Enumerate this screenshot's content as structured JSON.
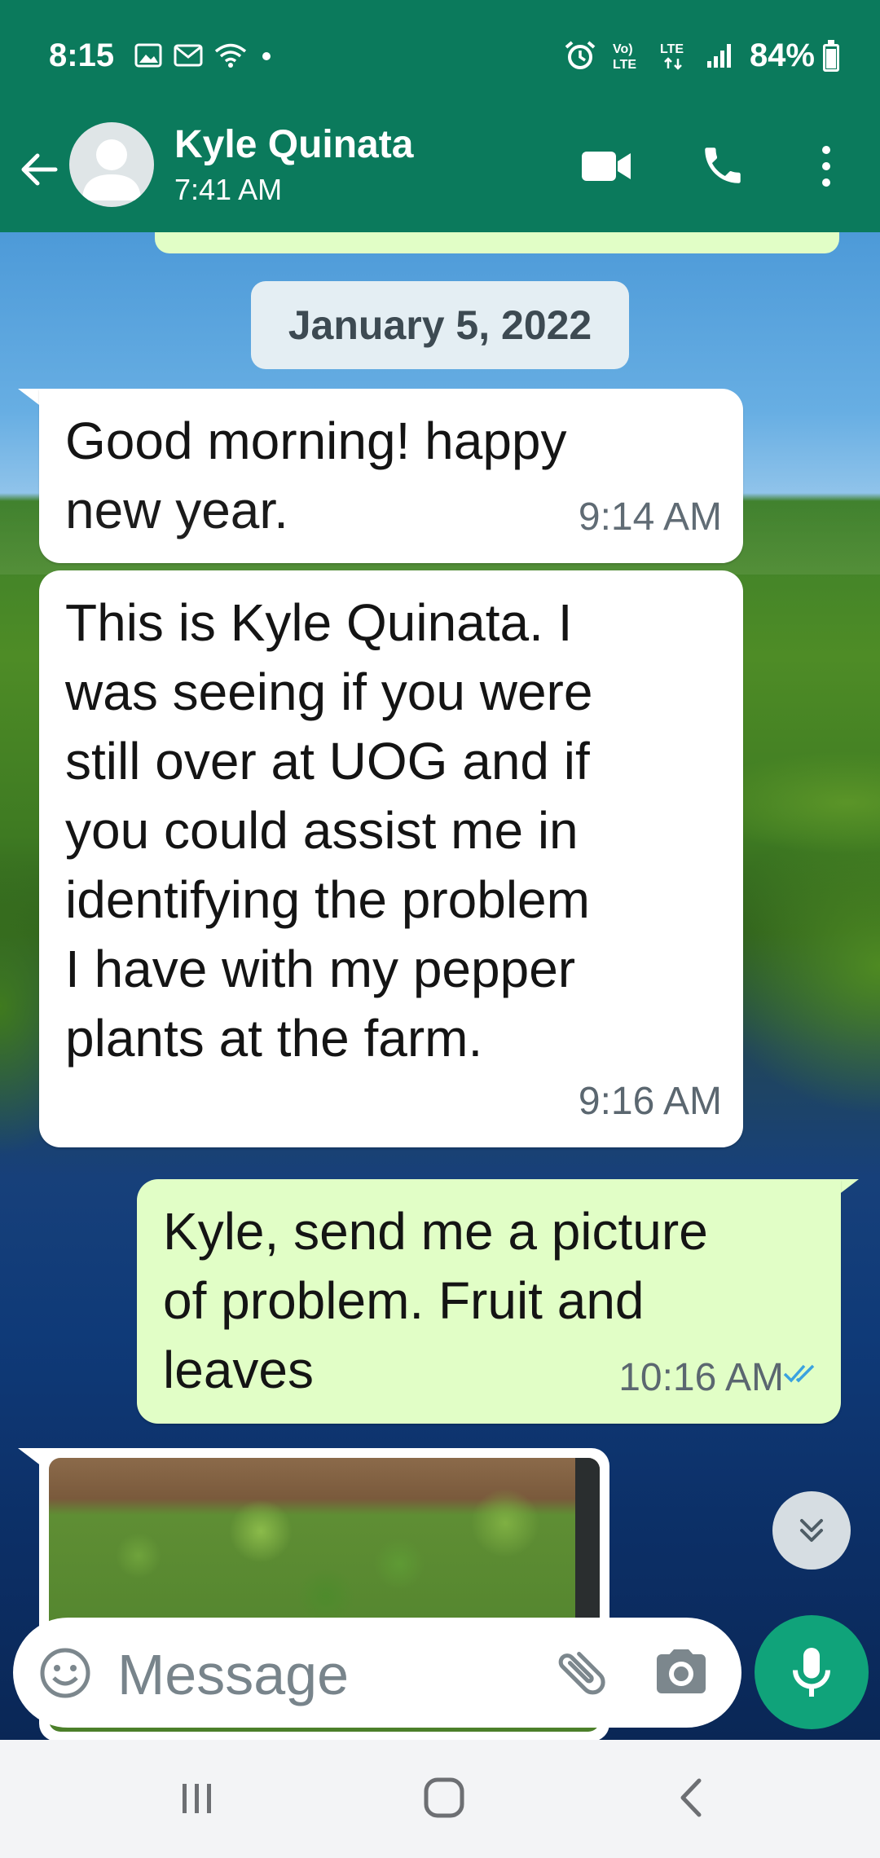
{
  "status_bar": {
    "time": "8:15",
    "network_label": "LTE",
    "volte_label": "Vo) LTE",
    "battery": "84%",
    "battery_level": 0.84,
    "icons": [
      "image-icon",
      "mail-icon",
      "wifi-icon",
      "dot-icon",
      "alarm-icon",
      "volte-icon",
      "lte-icon",
      "signal-icon",
      "battery-icon"
    ]
  },
  "header": {
    "contact_name": "Kyle Quinata",
    "subtitle": "7:41 AM",
    "icons": [
      "back-arrow-icon",
      "avatar",
      "video-call-icon",
      "phone-icon",
      "more-vertical-icon"
    ],
    "color": "#0b7a5c"
  },
  "chat": {
    "date_chip": "January 5, 2022",
    "messages": [
      {
        "direction": "incoming",
        "text": "Good morning! happy\nnew year.",
        "time": "9:14 AM"
      },
      {
        "direction": "incoming",
        "text": "This is Kyle Quinata. I\nwas seeing if you were\nstill over at UOG and if\nyou could assist me in\nidentifying the problem\nI have with my pepper\nplants at the farm.",
        "time": "9:16 AM"
      },
      {
        "direction": "outgoing",
        "text": "Kyle, send me a picture\nof problem.  Fruit and\nleaves",
        "time": "10:16 AM",
        "status_icon": "read-double-check-icon"
      },
      {
        "direction": "incoming",
        "type": "image"
      }
    ],
    "outgoing_color": "#e1fec6",
    "incoming_color": "#ffffff"
  },
  "composer": {
    "placeholder": "Message",
    "icons": [
      "emoji-icon",
      "attach-icon",
      "camera-icon",
      "mic-icon",
      "scroll-down-icon"
    ],
    "accent": "#10a37a"
  },
  "nav_bar": {
    "icons": [
      "recents-icon",
      "home-icon",
      "back-nav-icon"
    ]
  }
}
